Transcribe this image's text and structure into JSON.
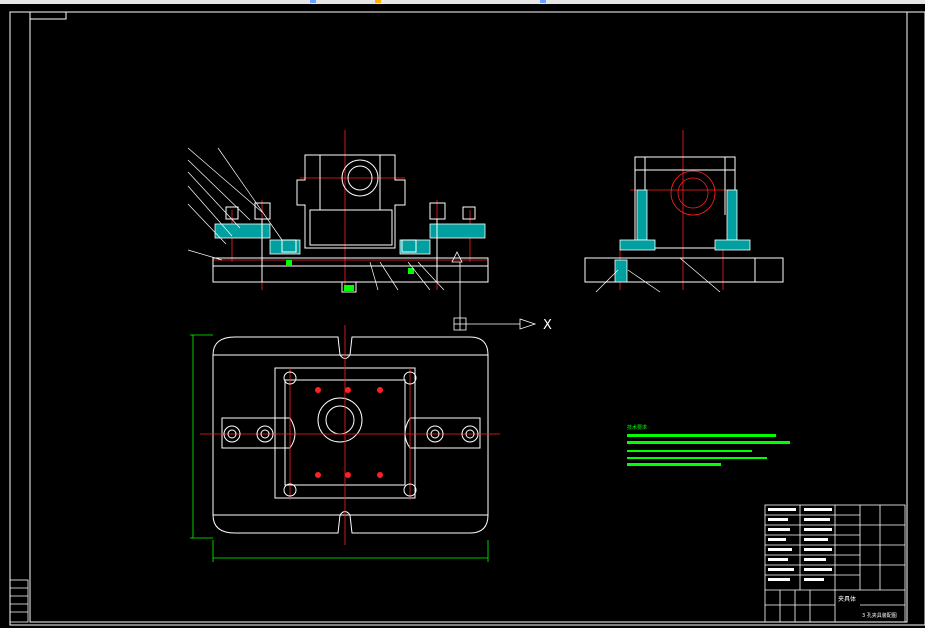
{
  "drawing": {
    "axis_label": "X",
    "colors": {
      "background": "#000000",
      "outline": "#ffffff",
      "centerline": "#ff2020",
      "dimension": "#00ff00",
      "hatch": "#00b0b0",
      "bolt": "#ffffff"
    }
  },
  "notes": {
    "heading": "技术要求",
    "lines": [
      "",
      "",
      "",
      "",
      ""
    ]
  },
  "title_block": {
    "drawing_name": "夹具体",
    "part_title": "3 孔夹具装配图"
  }
}
